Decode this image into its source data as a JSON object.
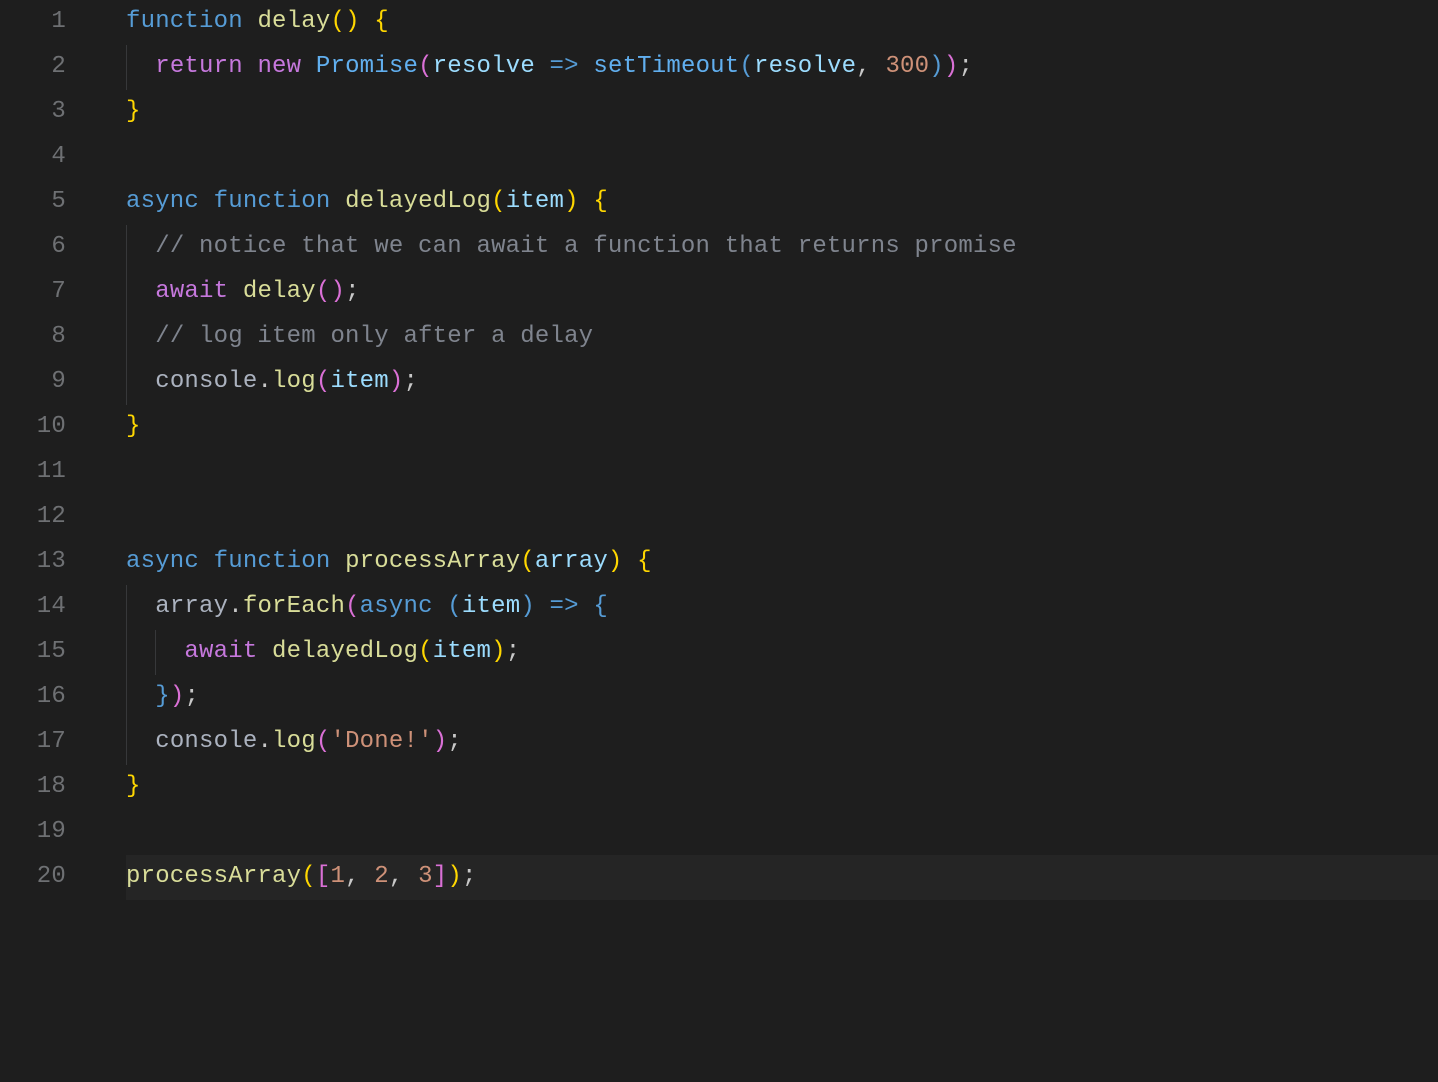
{
  "totalLines": 20,
  "currentLine": 20,
  "lines": {
    "1": [
      [
        "kw2",
        "function"
      ],
      [
        "punct",
        " "
      ],
      [
        "fndef",
        "delay"
      ],
      [
        "brace-y",
        "("
      ],
      [
        "brace-y",
        ")"
      ],
      [
        "punct",
        " "
      ],
      [
        "brace-y",
        "{"
      ]
    ],
    "2": [
      [
        "kw",
        "return"
      ],
      [
        "punct",
        " "
      ],
      [
        "kw",
        "new"
      ],
      [
        "punct",
        " "
      ],
      [
        "const",
        "Promise"
      ],
      [
        "brace-p",
        "("
      ],
      [
        "param",
        "resolve"
      ],
      [
        "punct",
        " "
      ],
      [
        "kw2",
        "=>"
      ],
      [
        "punct",
        " "
      ],
      [
        "const",
        "setTimeout"
      ],
      [
        "brace-b",
        "("
      ],
      [
        "param",
        "resolve"
      ],
      [
        "punct",
        ", "
      ],
      [
        "num",
        "300"
      ],
      [
        "brace-b",
        ")"
      ],
      [
        "brace-p",
        ")"
      ],
      [
        "punct",
        ";"
      ]
    ],
    "3": [
      [
        "brace-y",
        "}"
      ]
    ],
    "4": [],
    "5": [
      [
        "kw2",
        "async"
      ],
      [
        "punct",
        " "
      ],
      [
        "kw2",
        "function"
      ],
      [
        "punct",
        " "
      ],
      [
        "fndef",
        "delayedLog"
      ],
      [
        "brace-y",
        "("
      ],
      [
        "param",
        "item"
      ],
      [
        "brace-y",
        ")"
      ],
      [
        "punct",
        " "
      ],
      [
        "brace-y",
        "{"
      ]
    ],
    "6": [
      [
        "cmt",
        "// notice that we can await a function that returns promise"
      ]
    ],
    "7": [
      [
        "kw",
        "await"
      ],
      [
        "punct",
        " "
      ],
      [
        "fn",
        "delay"
      ],
      [
        "brace-p",
        "("
      ],
      [
        "brace-p",
        ")"
      ],
      [
        "punct",
        ";"
      ]
    ],
    "8": [
      [
        "cmt",
        "// log item only after a delay"
      ]
    ],
    "9": [
      [
        "id",
        "console"
      ],
      [
        "punct",
        "."
      ],
      [
        "fn",
        "log"
      ],
      [
        "brace-p",
        "("
      ],
      [
        "param",
        "item"
      ],
      [
        "brace-p",
        ")"
      ],
      [
        "punct",
        ";"
      ]
    ],
    "10": [
      [
        "brace-y",
        "}"
      ]
    ],
    "11": [],
    "12": [],
    "13": [
      [
        "kw2",
        "async"
      ],
      [
        "punct",
        " "
      ],
      [
        "kw2",
        "function"
      ],
      [
        "punct",
        " "
      ],
      [
        "fndef",
        "processArray"
      ],
      [
        "brace-y",
        "("
      ],
      [
        "param",
        "array"
      ],
      [
        "brace-y",
        ")"
      ],
      [
        "punct",
        " "
      ],
      [
        "brace-y",
        "{"
      ]
    ],
    "14": [
      [
        "id",
        "array"
      ],
      [
        "punct",
        "."
      ],
      [
        "fn",
        "forEach"
      ],
      [
        "brace-p",
        "("
      ],
      [
        "kw2",
        "async"
      ],
      [
        "punct",
        " "
      ],
      [
        "brace-b",
        "("
      ],
      [
        "param",
        "item"
      ],
      [
        "brace-b",
        ")"
      ],
      [
        "punct",
        " "
      ],
      [
        "kw2",
        "=>"
      ],
      [
        "punct",
        " "
      ],
      [
        "brace-b",
        "{"
      ]
    ],
    "15": [
      [
        "kw",
        "await"
      ],
      [
        "punct",
        " "
      ],
      [
        "fn",
        "delayedLog"
      ],
      [
        "brace-y",
        "("
      ],
      [
        "param",
        "item"
      ],
      [
        "brace-y",
        ")"
      ],
      [
        "punct",
        ";"
      ]
    ],
    "16": [
      [
        "brace-b",
        "}"
      ],
      [
        "brace-p",
        ")"
      ],
      [
        "punct",
        ";"
      ]
    ],
    "17": [
      [
        "id",
        "console"
      ],
      [
        "punct",
        "."
      ],
      [
        "fn",
        "log"
      ],
      [
        "brace-p",
        "("
      ],
      [
        "str",
        "'Done!'"
      ],
      [
        "brace-p",
        ")"
      ],
      [
        "punct",
        ";"
      ]
    ],
    "18": [
      [
        "brace-y",
        "}"
      ]
    ],
    "19": [],
    "20": [
      [
        "fn",
        "processArray"
      ],
      [
        "brace-y",
        "("
      ],
      [
        "brace-p",
        "["
      ],
      [
        "num",
        "1"
      ],
      [
        "punct",
        ", "
      ],
      [
        "num",
        "2"
      ],
      [
        "punct",
        ", "
      ],
      [
        "num",
        "3"
      ],
      [
        "brace-p",
        "]"
      ],
      [
        "brace-y",
        ")"
      ],
      [
        "punct",
        ";"
      ]
    ]
  },
  "indents": {
    "1": 0,
    "2": 1,
    "3": 0,
    "4": 0,
    "5": 0,
    "6": 1,
    "7": 1,
    "8": 1,
    "9": 1,
    "10": 0,
    "11": 0,
    "12": 0,
    "13": 0,
    "14": 1,
    "15": 2,
    "16": 1,
    "17": 1,
    "18": 0,
    "19": 0,
    "20": 0
  },
  "guideRanges": [
    {
      "col": 0,
      "from": 2,
      "to": 2
    },
    {
      "col": 0,
      "from": 6,
      "to": 9
    },
    {
      "col": 0,
      "from": 14,
      "to": 17
    },
    {
      "col": 1,
      "from": 15,
      "to": 15
    }
  ],
  "indentUnit": "  "
}
